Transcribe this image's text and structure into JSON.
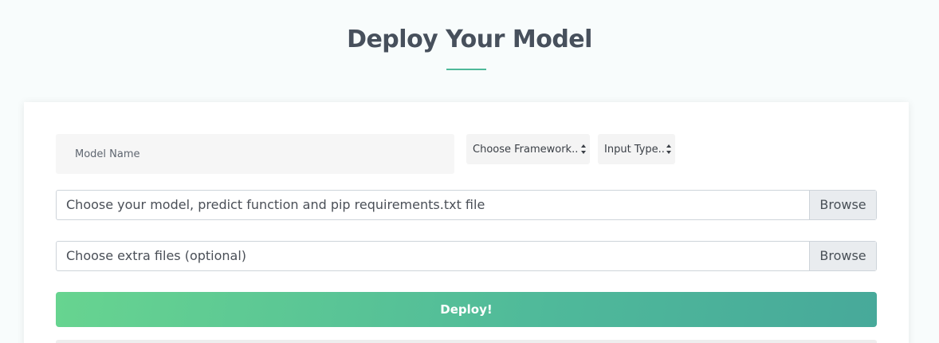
{
  "header": {
    "title": "Deploy Your Model"
  },
  "form": {
    "model_name": {
      "placeholder": "Model Name",
      "value": ""
    },
    "framework_select": {
      "selected": "Choose Framework..."
    },
    "input_type_select": {
      "selected": "Input Type..."
    },
    "model_files": {
      "label": "Choose your model, predict function and pip requirements.txt file",
      "browse_label": "Browse"
    },
    "extra_files": {
      "label": "Choose extra files (optional)",
      "browse_label": "Browse"
    },
    "deploy_label": "Deploy!"
  },
  "colors": {
    "accent": "#4fb99a",
    "accent_start": "#67d490",
    "title": "#47505c",
    "background": "#f8fcfc"
  },
  "icons": {
    "select_arrows": "up-down-caret-icon"
  }
}
